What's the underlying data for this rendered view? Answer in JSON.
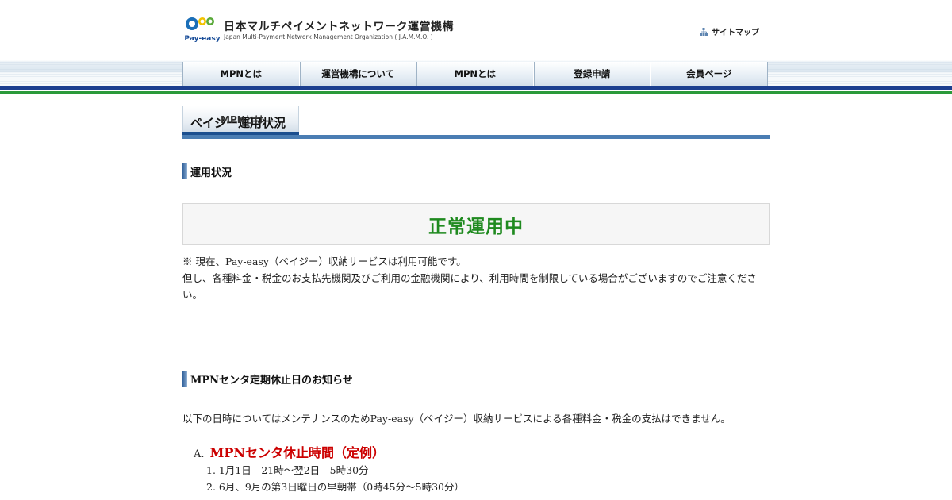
{
  "header": {
    "logo_mark_text": "Pay-easy",
    "org_name_jp": "日本マルチペイメントネットワーク運営機構",
    "org_name_en": "Japan Multi-Payment Network Management Organization ( J.A.M.M.O. )",
    "sitemap_label": "サイトマップ"
  },
  "nav": {
    "items": [
      {
        "label": "MPNとは"
      },
      {
        "label": "運営機構について"
      },
      {
        "label": "MPNとは"
      },
      {
        "label": "登録申請"
      },
      {
        "label": "会員ページ"
      }
    ]
  },
  "page": {
    "title": "ペイジー運用状況",
    "title_overlay": "MPNとは"
  },
  "status_section": {
    "heading": "運用状況",
    "status": "正常運用中",
    "note_line1": "※ 現在、Pay-easy（ペイジー）収納サービスは利用可能です。",
    "note_line2": "但し、各種料金・税金のお支払先機関及びご利用の金融機関により、利用時間を制限している場合がございますのでご注意ください。"
  },
  "maintenance_section": {
    "heading": "MPNセンタ定期休止日のお知らせ",
    "intro": "以下の日時についてはメンテナンスのためPay-easy（ペイジー）収納サービスによる各種料金・税金の支払はできません。",
    "list_marker": "A.",
    "list_heading": "MPNセンタ休止時間（定例）",
    "items": [
      "1. 1月1日　21時～翌2日　5時30分",
      "2. 6月、9月の第3日曜日の早朝帯（0時45分～5時30分）"
    ]
  },
  "colors": {
    "status_green": "#1f8a1f",
    "list_heading_red": "#cc0000",
    "nav_dark_blue": "#1b3f8f",
    "nav_green": "#2a9a3a",
    "title_rule_blue": "#4a7db3"
  }
}
